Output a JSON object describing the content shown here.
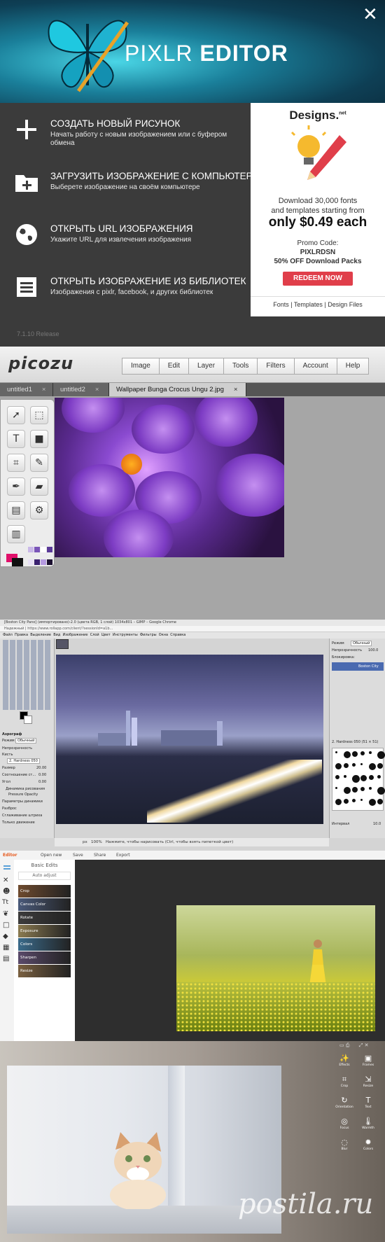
{
  "pixlr": {
    "title_light": "PIXLR",
    "title_bold": "EDITOR",
    "close_glyph": "✕",
    "menu": [
      {
        "title": "СОЗДАТЬ НОВЫЙ РИСУНОК",
        "subtitle": "Начать работу с новым изображением или с буфером обмена",
        "icon": "plus-icon"
      },
      {
        "title": "ЗАГРУЗИТЬ ИЗОБРАЖЕНИЕ С КОМПЬЮТЕР",
        "subtitle": "Выберете изображение на своём компьютере",
        "icon": "folder-plus-icon"
      },
      {
        "title": "ОТКРЫТЬ URL ИЗОБРАЖЕНИЯ",
        "subtitle": "Укажите URL для извлечения изображения",
        "icon": "globe-icon"
      },
      {
        "title": "ОТКРЫТЬ ИЗОБРАЖЕНИЕ ИЗ БИБЛИОТЕК",
        "subtitle": "Изображения с pixlr, facebook, и других библиотек",
        "icon": "library-icon"
      }
    ],
    "version": "7.1.10 Release",
    "ad": {
      "logo": "Designs.",
      "logo_sup": "net",
      "line1": "Download 30,000 fonts",
      "line2": "and templates starting from",
      "price": "only $0.49 each",
      "promo_label": "Promo Code:",
      "promo_code": "PIXLRDSN",
      "promo_offer": "50% OFF Download Packs",
      "button": "REDEEM NOW",
      "footer": "Fonts | Templates | Design Files"
    }
  },
  "picozu": {
    "logo": "picozu",
    "menu": [
      "Image",
      "Edit",
      "Layer",
      "Tools",
      "Filters",
      "Account",
      "Help"
    ],
    "tabs": [
      {
        "label": "untitled1",
        "close": "×"
      },
      {
        "label": "untitled2",
        "close": "×"
      },
      {
        "label": "Wallpaper Bunga Crocus Ungu 2.jpg",
        "close": "×"
      }
    ],
    "colors": {
      "primary": "#e0106a",
      "secondary": "#111111"
    },
    "swatches": [
      "#c9b8e8",
      "#7a55b8",
      "#ffffff",
      "#5a3a98",
      "#e8e0f5",
      "#3a2070",
      "#b59ae0",
      "#1c1030"
    ]
  },
  "gimp": {
    "window_title": "[Boston City Pano] (импортировано)-2.0 (цвета RGB, 1 слой) 1034x801 – GIMP – Google Chrome",
    "url": "Надежный | https://www.rollapp.com/client/?sessionId=a1b...",
    "menu": [
      "Файл",
      "Правка",
      "Выделение",
      "Вид",
      "Изображение",
      "Слой",
      "Цвет",
      "Инструменты",
      "Фильтры",
      "Окна",
      "Справка"
    ],
    "tool_options": {
      "title": "Аэрограф",
      "mode_label": "Режим",
      "mode_value": "Обычный",
      "opacity_label": "Непрозрачность",
      "opacity_value": "100.0",
      "brush_label": "Кисть",
      "brush_value": "2. Hardness 050",
      "size_label": "Размер",
      "size_value": "20.00",
      "ratio_label": "Соотношение ст...",
      "ratio_value": "0.00",
      "angle_label": "Угол",
      "angle_value": "0.00",
      "dynamics_label": "Динамика рисования",
      "dynamics_value": "Pressure Opacity",
      "dynamics_params": "Параметры динамики",
      "scatter": "Разброс",
      "smooth": "Сглаживание штриха",
      "motion_only": "Только движение"
    },
    "layers": {
      "mode_label": "Режим",
      "mode_value": "Обычный",
      "opacity_label": "Непрозрачность",
      "opacity_value": "100.0",
      "lock_label": "Блокировка:",
      "layer_name": "Boston City",
      "brush_name": "2. Hardness 050 (51 × 51)",
      "spacing_label": "Интервал",
      "spacing_value": "10.0"
    },
    "status": {
      "unit": "px",
      "zoom": "100%",
      "message": "Нажмите, чтобы нарисовать (Ctrl, чтобы взять пипеткой цвет)"
    }
  },
  "photo_editor": {
    "top": [
      "Editor",
      "Open new",
      "Save",
      "Share",
      "Export"
    ],
    "panel_title": "Basic Edits",
    "auto_adjust": "Auto adjust",
    "tiles": [
      "Crop",
      "Canvas Color",
      "Rotate",
      "Exposure",
      "Colors",
      "Sharpen",
      "Resize"
    ],
    "tile_colors": [
      "#6e4a2e",
      "#4a5a7a",
      "#3c3c3c",
      "#8a7a50",
      "#3a6a8a",
      "#5a4a6a",
      "#7a6040"
    ]
  },
  "cat_editor": {
    "tools": [
      {
        "icon": "✨",
        "label": "Effects",
        "name": "effects"
      },
      {
        "icon": "▣",
        "label": "Frames",
        "name": "frames"
      },
      {
        "icon": "⌗",
        "label": "Crop",
        "name": "crop"
      },
      {
        "icon": "⇲",
        "label": "Resize",
        "name": "resize"
      },
      {
        "icon": "↻",
        "label": "Orientation",
        "name": "orientation"
      },
      {
        "icon": "T",
        "label": "Text",
        "name": "text"
      },
      {
        "icon": "◎",
        "label": "Focus",
        "name": "focus"
      },
      {
        "icon": "🌡",
        "label": "Warmth",
        "name": "warmth"
      },
      {
        "icon": "◌",
        "label": "Blur",
        "name": "blur"
      },
      {
        "icon": "✹",
        "label": "Colors",
        "name": "colors"
      }
    ],
    "watermark": "postila.ru"
  }
}
